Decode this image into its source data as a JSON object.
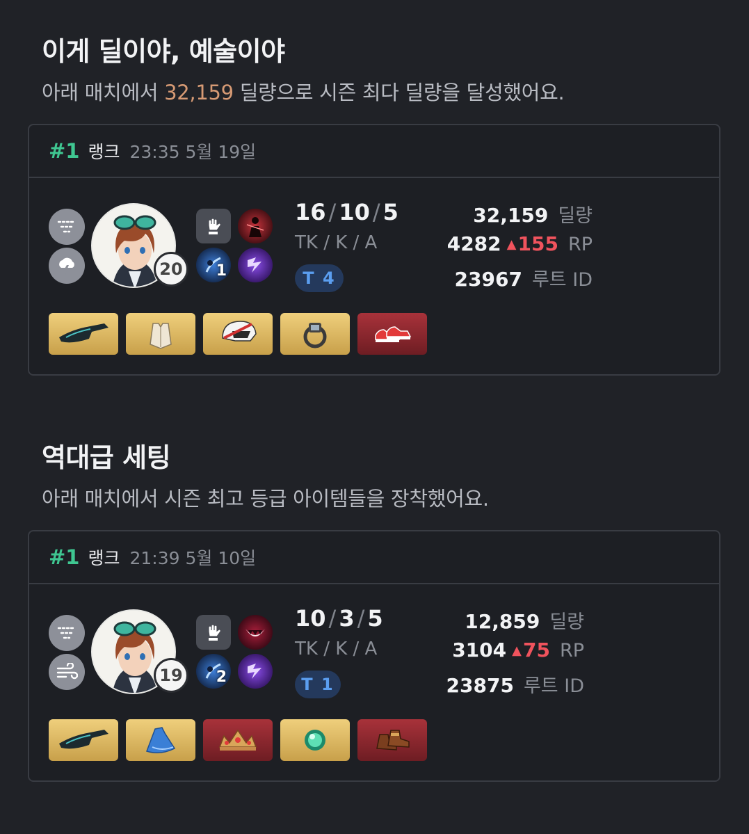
{
  "sections": [
    {
      "title": "이게 딜이야, 예술이야",
      "subtitle_pre": "아래 매치에서 ",
      "subtitle_hl": "32,159",
      "subtitle_post": " 딜량으로 시즌 최다 딜량을 달성했어요.",
      "card": {
        "rank": "#1",
        "rank_label": "랭크",
        "time": "23:35 5월 19일",
        "spells": [
          "filter-icon",
          "storm-cloud-icon"
        ],
        "level": "20",
        "skill_level": "1",
        "kda": {
          "kills": "16",
          "tk": "10",
          "assists": "5",
          "label": "TK / K / A"
        },
        "tier": "T 4",
        "damage": "32,159",
        "damage_label": "딜량",
        "rp": "4282",
        "rp_change": "155",
        "rp_label": "RP",
        "loot_id": "23967",
        "loot_label": "루트 ID",
        "items": [
          {
            "name": "gauntlet-item",
            "rarity": "gold"
          },
          {
            "name": "armor-vest-item",
            "rarity": "gold"
          },
          {
            "name": "racing-helmet-item",
            "rarity": "gold"
          },
          {
            "name": "ring-item",
            "rarity": "gold"
          },
          {
            "name": "sneakers-item",
            "rarity": "red"
          }
        ]
      }
    },
    {
      "title": "역대급 세팅",
      "subtitle_pre": "아래 매치에서 시즌 최고 등급 아이템들을 장착했어요.",
      "subtitle_hl": "",
      "subtitle_post": "",
      "card": {
        "rank": "#1",
        "rank_label": "랭크",
        "time": "21:39 5월 10일",
        "spells": [
          "filter-icon",
          "wind-icon"
        ],
        "level": "19",
        "skill_level": "2",
        "kda": {
          "kills": "10",
          "tk": "3",
          "assists": "5",
          "label": "TK / K / A"
        },
        "tier": "T 1",
        "damage": "12,859",
        "damage_label": "딜량",
        "rp": "3104",
        "rp_change": "75",
        "rp_label": "RP",
        "loot_id": "23875",
        "loot_label": "루트 ID",
        "items": [
          {
            "name": "gauntlet-item",
            "rarity": "gold"
          },
          {
            "name": "dress-item",
            "rarity": "gold"
          },
          {
            "name": "tiara-item",
            "rarity": "red"
          },
          {
            "name": "jade-orb-item",
            "rarity": "gold"
          },
          {
            "name": "boots-item",
            "rarity": "red"
          }
        ]
      }
    }
  ],
  "colors": {
    "background": "#202227",
    "rank_green": "#3fc691",
    "highlight": "#d69a74",
    "rp_up": "#f0535d",
    "tier_blue": "#5b9ef0",
    "gold_item": "#d9b45f",
    "red_item": "#8a2830"
  }
}
